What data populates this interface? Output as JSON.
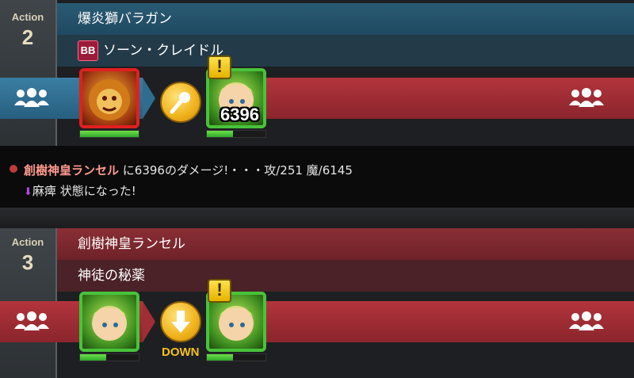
{
  "action2": {
    "label": "Action",
    "number": "2",
    "monster_name": "爆炎獅バラガン",
    "skill_badge": "BB",
    "skill_name": "ソーン・クレイドル",
    "damage": "6396",
    "attacker_hp": 1.0,
    "target_hp": 0.45,
    "skill_icon": "microphone-icon",
    "party_icon": "party-icon"
  },
  "log": {
    "line1_name": "創樹神皇ランセル",
    "line1_text": "に6396のダメージ!・・・攻/251 魔/6145",
    "line2_name": "麻痺",
    "line2_text": "状態になった!"
  },
  "action3": {
    "label": "Action",
    "number": "3",
    "monster_name": "創樹神皇ランセル",
    "skill_name": "神徒の秘薬",
    "effect_label": "DOWN",
    "attacker_hp": 0.45,
    "target_hp": 0.45,
    "skill_icon": "arrow-down-icon",
    "party_icon": "party-icon"
  },
  "colors": {
    "blue_lane": "#2f6d8f",
    "red_lane": "#a12d35",
    "gold": "#f0b21a"
  }
}
